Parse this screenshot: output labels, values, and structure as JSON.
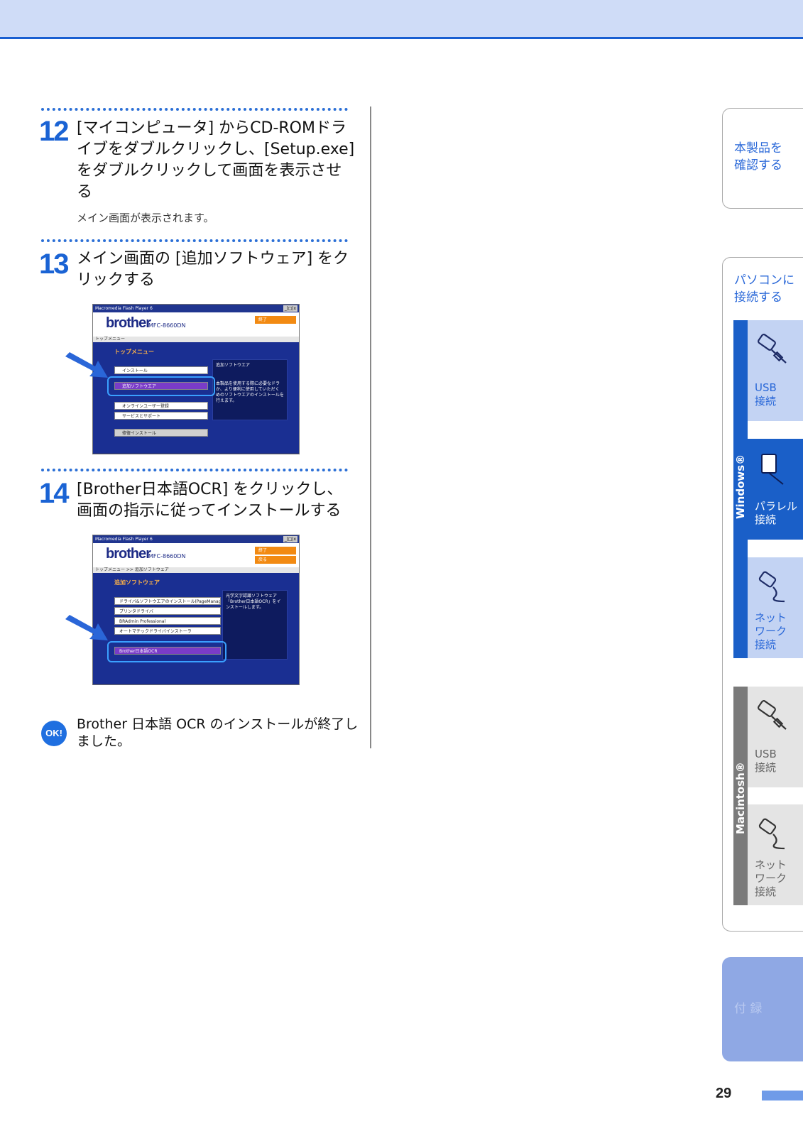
{
  "step12": {
    "number": "12",
    "text": "[マイコンピュータ] からCD-ROMドライブをダブルクリックし、[Setup.exe]をダブルクリックして画面を表示させる",
    "note": "メイン画面が表示されます。"
  },
  "step13": {
    "number": "13",
    "text": "メイン画面の [追加ソフトウェア] をクリックする",
    "screenshot": {
      "title": "Macromedia Flash Player 6",
      "winbtns": "_|□|x",
      "brand": "brother",
      "model": "MFC-8660DN",
      "exit": "終了",
      "crumb": "トップメニュー",
      "section": "トップメニュー",
      "buttons": [
        "インストール",
        "追加ソフトウエア",
        "オンラインユーザー登録",
        "サービスとサポート",
        "修復インストール"
      ],
      "panel_title": "追加ソフトウエア",
      "panel_text": "本製品を使用する際に必要なドラ か、より便利に使用していただく めのソフトウエアのインストールを行えます。"
    }
  },
  "step14": {
    "number": "14",
    "text": "[Brother日本語OCR] をクリックし、画面の指示に従ってインストールする",
    "screenshot": {
      "title": "Macromedia Flash Player 6",
      "winbtns": "_|□|x",
      "brand": "brother",
      "model": "MFC-8660DN",
      "exit": "終了",
      "back": "戻る",
      "crumb": "トップメニュー >> 追加ソフトウェア",
      "section": "追加ソフトウェア",
      "buttons": [
        "ドライバ&ソフトウエアのインストール(PageManager 以外)",
        "プリンタドライバ",
        "BRAdmin Professional",
        "オートマチックドライバインストーラ",
        "Brother日本語OCR"
      ],
      "panel_text": "光学文字認識ソフトウェア「Brother日本語OCR」をインストールします。"
    }
  },
  "ok": {
    "icon": "OK!",
    "text": "Brother 日本語 OCR のインストールが終了しました。"
  },
  "sidebar": {
    "tab1": [
      "本製品を",
      "確認する"
    ],
    "tab2": [
      "パソコンに",
      "接続する"
    ],
    "windows_label": "Windows®",
    "macintosh_label": "Macintosh®",
    "win_usb": [
      "USB",
      "接続"
    ],
    "win_parallel": [
      "パラレル",
      "接続"
    ],
    "win_network": [
      "ネット",
      "ワーク",
      "接続"
    ],
    "mac_usb": [
      "USB",
      "接続"
    ],
    "mac_network": [
      "ネット",
      "ワーク",
      "接続"
    ],
    "appendix": "付 録"
  },
  "page_number": "29",
  "colors": {
    "accent": "#1a63d4",
    "tab_active": "#1a5fc8",
    "tab_inactive": "#c3d3f3",
    "mac_bar": "#7a7a7a"
  }
}
